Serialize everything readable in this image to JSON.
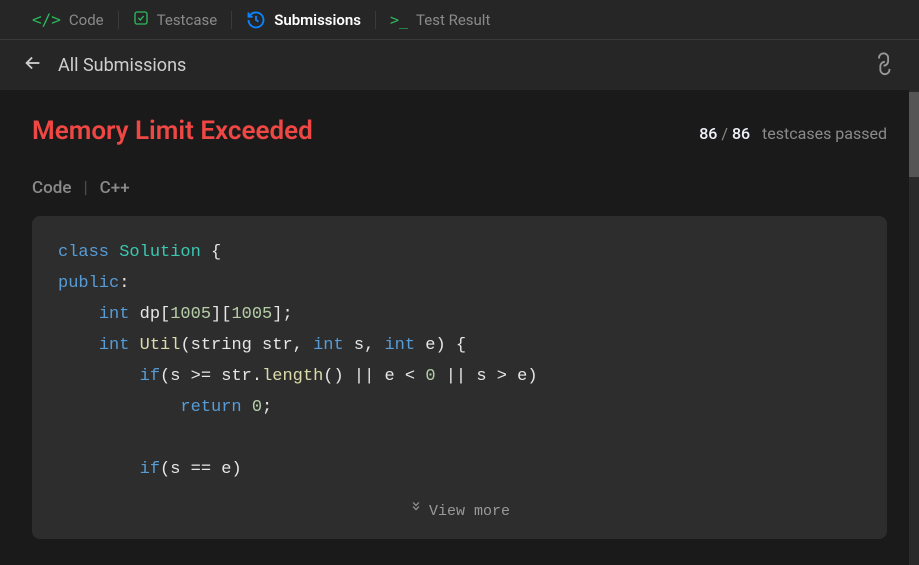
{
  "tabs": {
    "code": "Code",
    "testcase": "Testcase",
    "submissions": "Submissions",
    "testresult": "Test Result"
  },
  "subheader": {
    "back_label": "All Submissions"
  },
  "status": {
    "verdict": "Memory Limit Exceeded",
    "passed": "86",
    "total": "86",
    "suffix": "testcases passed"
  },
  "code_section": {
    "label": "Code",
    "language": "C++",
    "view_more": "View more"
  },
  "code": {
    "l1_class": "class",
    "l1_name": "Solution",
    "l1_brace": " {",
    "l2_public": "public",
    "l2_colon": ":",
    "l3_indent": "    ",
    "l3_type": "int",
    "l3_rest1": " dp[",
    "l3_n1": "1005",
    "l3_rest2": "][",
    "l3_n2": "1005",
    "l3_rest3": "];",
    "l4_indent": "    ",
    "l4_type": "int",
    "l4_sp": " ",
    "l4_func": "Util",
    "l4_p1": "(string str, ",
    "l4_t2": "int",
    "l4_p2": " s, ",
    "l4_t3": "int",
    "l4_p3": " e) {",
    "l5_indent": "        ",
    "l5_if": "if",
    "l5_rest1": "(s >= str.",
    "l5_len": "length",
    "l5_rest2": "() || e < ",
    "l5_zero": "0",
    "l5_rest3": " || s > e)",
    "l6_indent": "            ",
    "l6_return": "return",
    "l6_sp": " ",
    "l6_zero": "0",
    "l6_semi": ";",
    "l7_blank": " ",
    "l8_indent": "        ",
    "l8_if": "if",
    "l8_rest": "(s == e)"
  }
}
